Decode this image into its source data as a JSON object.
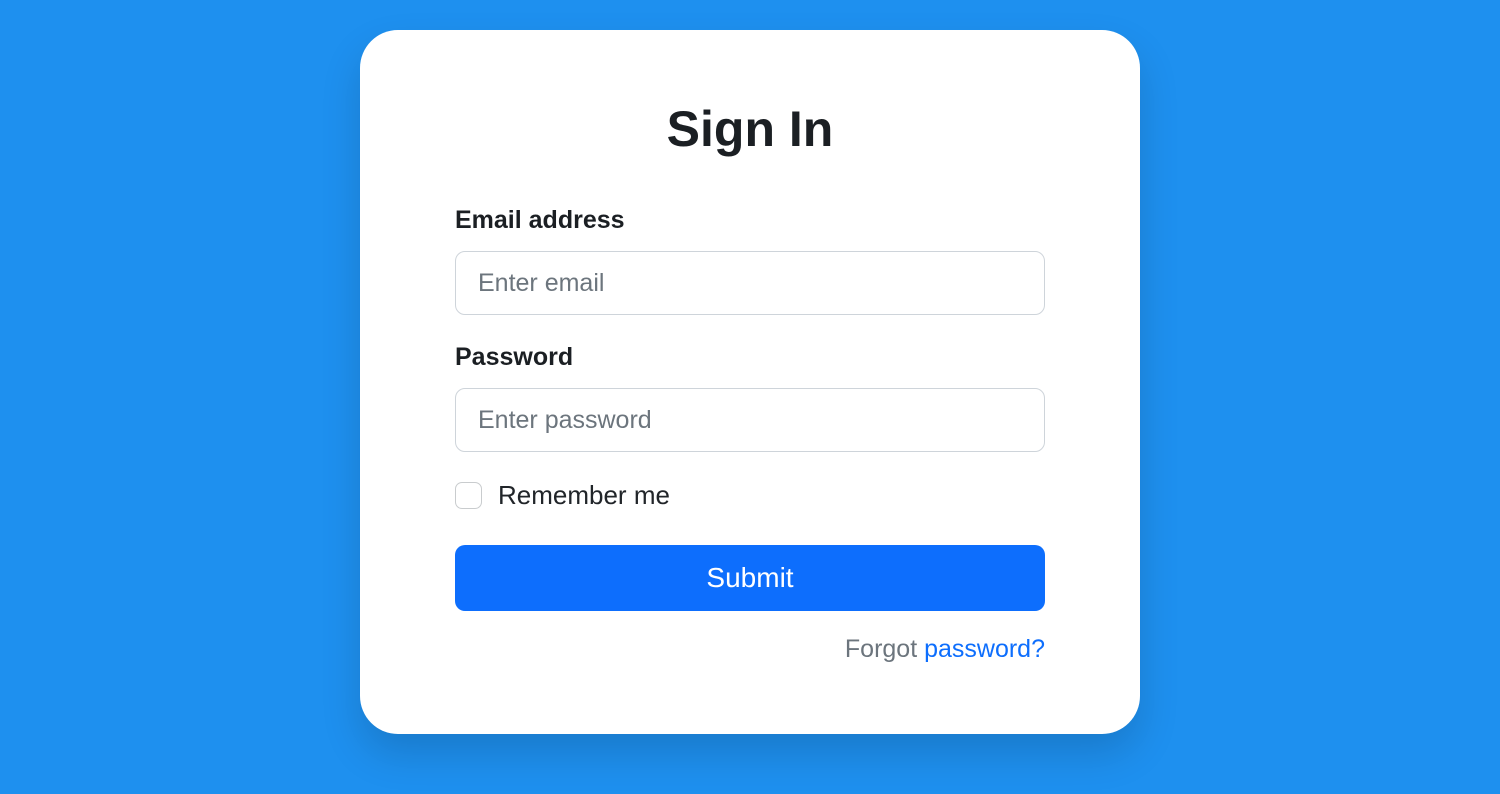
{
  "card": {
    "title": "Sign In",
    "email": {
      "label": "Email address",
      "placeholder": "Enter email",
      "value": ""
    },
    "password": {
      "label": "Password",
      "placeholder": "Enter password",
      "value": ""
    },
    "remember": {
      "label": "Remember me",
      "checked": false
    },
    "submit_label": "Submit",
    "forgot": {
      "prefix": "Forgot ",
      "link": "password?"
    }
  }
}
